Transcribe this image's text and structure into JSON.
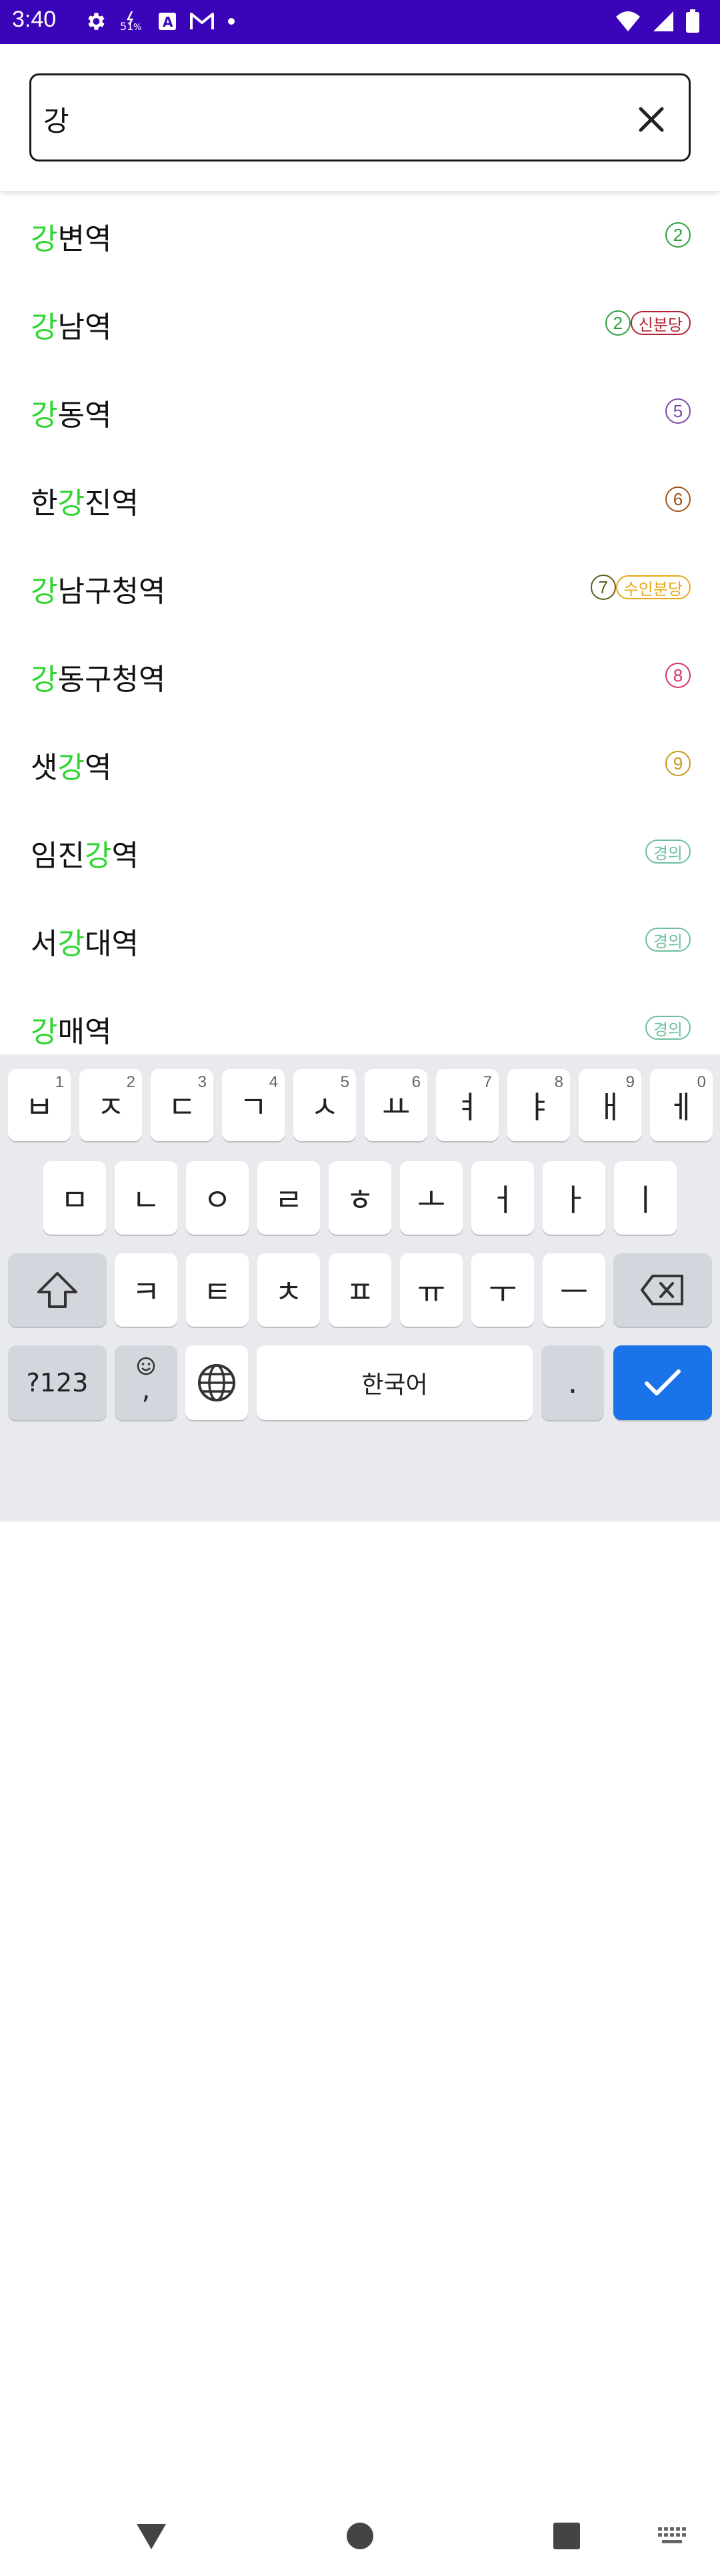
{
  "status_bar": {
    "time": "3:40",
    "left_icons": [
      "gear-icon",
      "data-saver-icon",
      "text-a-icon",
      "gmail-icon",
      "dot-icon"
    ],
    "right_icons": [
      "wifi-icon",
      "signal-icon",
      "battery-icon"
    ]
  },
  "search": {
    "value": "강",
    "placeholder": ""
  },
  "colors": {
    "highlight": "#2fd62f",
    "line2": "#2e9e3a",
    "sinbundang": "#b22234",
    "line5": "#7b4aa5",
    "line6": "#a0521a",
    "line7": "#5d5e1a",
    "suinbundang": "#e6a817",
    "line8": "#d6336c",
    "line9": "#c99a1c",
    "gyeongui": "#6dbf9c",
    "enter_key": "#1a73e8"
  },
  "results": [
    {
      "pre": "",
      "hl": "강",
      "post": "변역",
      "badges": [
        {
          "type": "circle",
          "text": "2",
          "color": "#2e9e3a"
        }
      ]
    },
    {
      "pre": "",
      "hl": "강",
      "post": "남역",
      "badges": [
        {
          "type": "circle",
          "text": "2",
          "color": "#2e9e3a"
        },
        {
          "type": "pill",
          "text": "신분당",
          "color": "#b22234"
        }
      ]
    },
    {
      "pre": "",
      "hl": "강",
      "post": "동역",
      "badges": [
        {
          "type": "circle",
          "text": "5",
          "color": "#7b4aa5"
        }
      ]
    },
    {
      "pre": "한",
      "hl": "강",
      "post": "진역",
      "badges": [
        {
          "type": "circle",
          "text": "6",
          "color": "#a0521a"
        }
      ]
    },
    {
      "pre": "",
      "hl": "강",
      "post": "남구청역",
      "badges": [
        {
          "type": "circle",
          "text": "7",
          "color": "#5d5e1a"
        },
        {
          "type": "pill",
          "text": "수인분당",
          "color": "#e6a817"
        }
      ]
    },
    {
      "pre": "",
      "hl": "강",
      "post": "동구청역",
      "badges": [
        {
          "type": "circle",
          "text": "8",
          "color": "#d6336c"
        }
      ]
    },
    {
      "pre": "샛",
      "hl": "강",
      "post": "역",
      "badges": [
        {
          "type": "circle",
          "text": "9",
          "color": "#c99a1c"
        }
      ]
    },
    {
      "pre": "임진",
      "hl": "강",
      "post": "역",
      "badges": [
        {
          "type": "pill",
          "text": "경의",
          "color": "#6dbf9c"
        }
      ]
    },
    {
      "pre": "서",
      "hl": "강",
      "post": "대역",
      "badges": [
        {
          "type": "pill",
          "text": "경의",
          "color": "#6dbf9c"
        }
      ]
    },
    {
      "pre": "",
      "hl": "강",
      "post": "매역",
      "badges": [
        {
          "type": "pill",
          "text": "경의",
          "color": "#6dbf9c"
        }
      ]
    }
  ],
  "keyboard": {
    "row1": [
      {
        "label": "ㅂ",
        "hint": "1"
      },
      {
        "label": "ㅈ",
        "hint": "2"
      },
      {
        "label": "ㄷ",
        "hint": "3"
      },
      {
        "label": "ㄱ",
        "hint": "4"
      },
      {
        "label": "ㅅ",
        "hint": "5"
      },
      {
        "label": "ㅛ",
        "hint": "6"
      },
      {
        "label": "ㅕ",
        "hint": "7"
      },
      {
        "label": "ㅑ",
        "hint": "8"
      },
      {
        "label": "ㅐ",
        "hint": "9"
      },
      {
        "label": "ㅔ",
        "hint": "0"
      }
    ],
    "row2": [
      "ㅁ",
      "ㄴ",
      "ㅇ",
      "ㄹ",
      "ㅎ",
      "ㅗ",
      "ㅓ",
      "ㅏ",
      "ㅣ"
    ],
    "row3": [
      "ㅋ",
      "ㅌ",
      "ㅊ",
      "ㅍ",
      "ㅠ",
      "ㅜ",
      "ㅡ"
    ],
    "symbols_label": "?123",
    "comma_label": ",",
    "space_label": "한국어",
    "period_label": "."
  }
}
